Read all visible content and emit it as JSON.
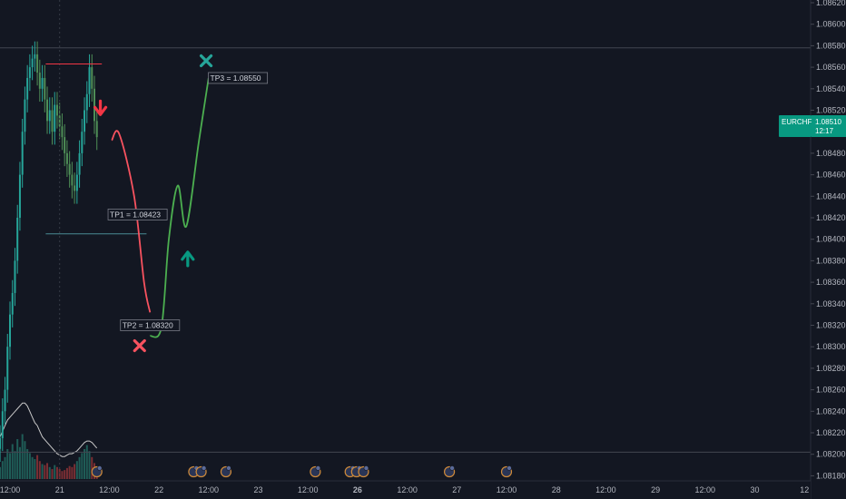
{
  "symbol_badge": {
    "symbol": "EURCHF",
    "price": "1.08510",
    "countdown": "12:17",
    "color": "#089981"
  },
  "chart_data": {
    "type": "line",
    "title": "",
    "xlabel": "",
    "ylabel": "",
    "ylim": [
      1.0818,
      1.0862
    ],
    "grid": false,
    "price_labels": [
      "1.08620",
      "1.08600",
      "1.08580",
      "1.08560",
      "1.08540",
      "1.08520",
      "1.08500",
      "1.08480",
      "1.08460",
      "1.08440",
      "1.08420",
      "1.08400",
      "1.08380",
      "1.08360",
      "1.08340",
      "1.08320",
      "1.08300",
      "1.08280",
      "1.08260",
      "1.08240",
      "1.08220",
      "1.08200",
      "1.08180"
    ],
    "time_labels": [
      {
        "t": 0,
        "label": "12:00",
        "bold": false
      },
      {
        "t": 1,
        "label": "21",
        "bold": false
      },
      {
        "t": 2,
        "label": "12:00",
        "bold": false
      },
      {
        "t": 3,
        "label": "22",
        "bold": false
      },
      {
        "t": 4,
        "label": "12:00",
        "bold": false
      },
      {
        "t": 5,
        "label": "23",
        "bold": false
      },
      {
        "t": 6,
        "label": "12:00",
        "bold": false
      },
      {
        "t": 7,
        "label": "26",
        "bold": true
      },
      {
        "t": 8,
        "label": "12:00",
        "bold": false
      },
      {
        "t": 9,
        "label": "27",
        "bold": false
      },
      {
        "t": 10,
        "label": "12:00",
        "bold": false
      },
      {
        "t": 11,
        "label": "28",
        "bold": false
      },
      {
        "t": 12,
        "label": "12:00",
        "bold": false
      },
      {
        "t": 13,
        "label": "29",
        "bold": false
      },
      {
        "t": 14,
        "label": "12:00",
        "bold": false
      },
      {
        "t": 15,
        "label": "30",
        "bold": false
      },
      {
        "t": 16,
        "label": "12",
        "bold": false
      }
    ],
    "horizontal_levels": [
      {
        "name": "upper-level",
        "price": 1.08578,
        "color": "#434651"
      },
      {
        "name": "lower-level",
        "price": 1.08202,
        "color": "#434651"
      }
    ],
    "take_profits": [
      {
        "label": "TP1 = 1.08423",
        "price": 1.08423
      },
      {
        "label": "TP2 = 1.08320",
        "price": 1.0832
      },
      {
        "label": "TP3 = 1.08550",
        "price": 1.0855
      }
    ],
    "resistance_line": {
      "price": 1.08563,
      "t_start": 0.72,
      "t_end": 1.85,
      "color": "#f23645"
    },
    "support_line": {
      "price": 1.08405,
      "t_start": 0.72,
      "t_end": 2.75,
      "color": "#4a8c94"
    },
    "bearish_path": {
      "color": "#f7525f",
      "points": [
        [
          2.05,
          1.08492
        ],
        [
          2.2,
          1.08498
        ],
        [
          2.5,
          1.0844
        ],
        [
          2.7,
          1.0836
        ],
        [
          2.82,
          1.08332
        ]
      ]
    },
    "bullish_path": {
      "color": "#4caf50",
      "points": [
        [
          2.82,
          1.0831
        ],
        [
          3.05,
          1.08318
        ],
        [
          3.2,
          1.084
        ],
        [
          3.38,
          1.0845
        ],
        [
          3.55,
          1.08412
        ],
        [
          3.8,
          1.0849
        ],
        [
          4.0,
          1.0855
        ]
      ]
    },
    "markers": [
      {
        "kind": "arrow-down",
        "t": 1.82,
        "price": 1.08521,
        "color": "#f23645"
      },
      {
        "kind": "cross",
        "t": 2.61,
        "price": 1.08301,
        "color": "#f7525f"
      },
      {
        "kind": "arrow-up",
        "t": 3.58,
        "price": 1.08383,
        "color": "#089981"
      },
      {
        "kind": "cross",
        "t": 3.95,
        "price": 1.08566,
        "color": "#26a69a"
      }
    ],
    "price_series": {
      "name": "EURCHF",
      "t_start": -0.2,
      "t_step": 0.05,
      "color": "#26a69a",
      "closes": [
        1.08215,
        1.0824,
        1.0826,
        1.083,
        1.0833,
        1.0835,
        1.0838,
        1.0842,
        1.0846,
        1.085,
        1.0853,
        1.0855,
        1.0856,
        1.08568,
        1.08572,
        1.08555,
        1.0854,
        1.0855,
        1.0853,
        1.0851,
        1.0852,
        1.085,
        1.08525,
        1.08515,
        1.08505,
        1.08495,
        1.0848,
        1.0847,
        1.0846,
        1.0845,
        1.08445,
        1.0846,
        1.0848,
        1.085,
        1.0852,
        1.08535,
        1.0856,
        1.0854,
        1.0851,
        1.08495
      ],
      "volume": [
        12,
        18,
        22,
        30,
        26,
        35,
        28,
        40,
        32,
        45,
        38,
        30,
        26,
        22,
        20,
        24,
        18,
        15,
        14,
        16,
        12,
        10,
        14,
        12,
        10,
        8,
        9,
        11,
        13,
        12,
        15,
        18,
        22,
        26,
        30,
        34,
        28,
        22,
        16,
        10
      ],
      "volume_ma": [
        30,
        34,
        38,
        42,
        44,
        46,
        48,
        50,
        52,
        54,
        54,
        52,
        48,
        44,
        40,
        38,
        34,
        30,
        28,
        26,
        24,
        22,
        20,
        18,
        17,
        16,
        16,
        17,
        18,
        18,
        19,
        20,
        22,
        24,
        26,
        27,
        27,
        26,
        24,
        22
      ]
    },
    "event_icons": [
      1.75,
      3.7,
      3.85,
      4.35,
      6.15,
      6.85,
      6.98,
      7.12,
      8.85,
      10.0
    ]
  }
}
